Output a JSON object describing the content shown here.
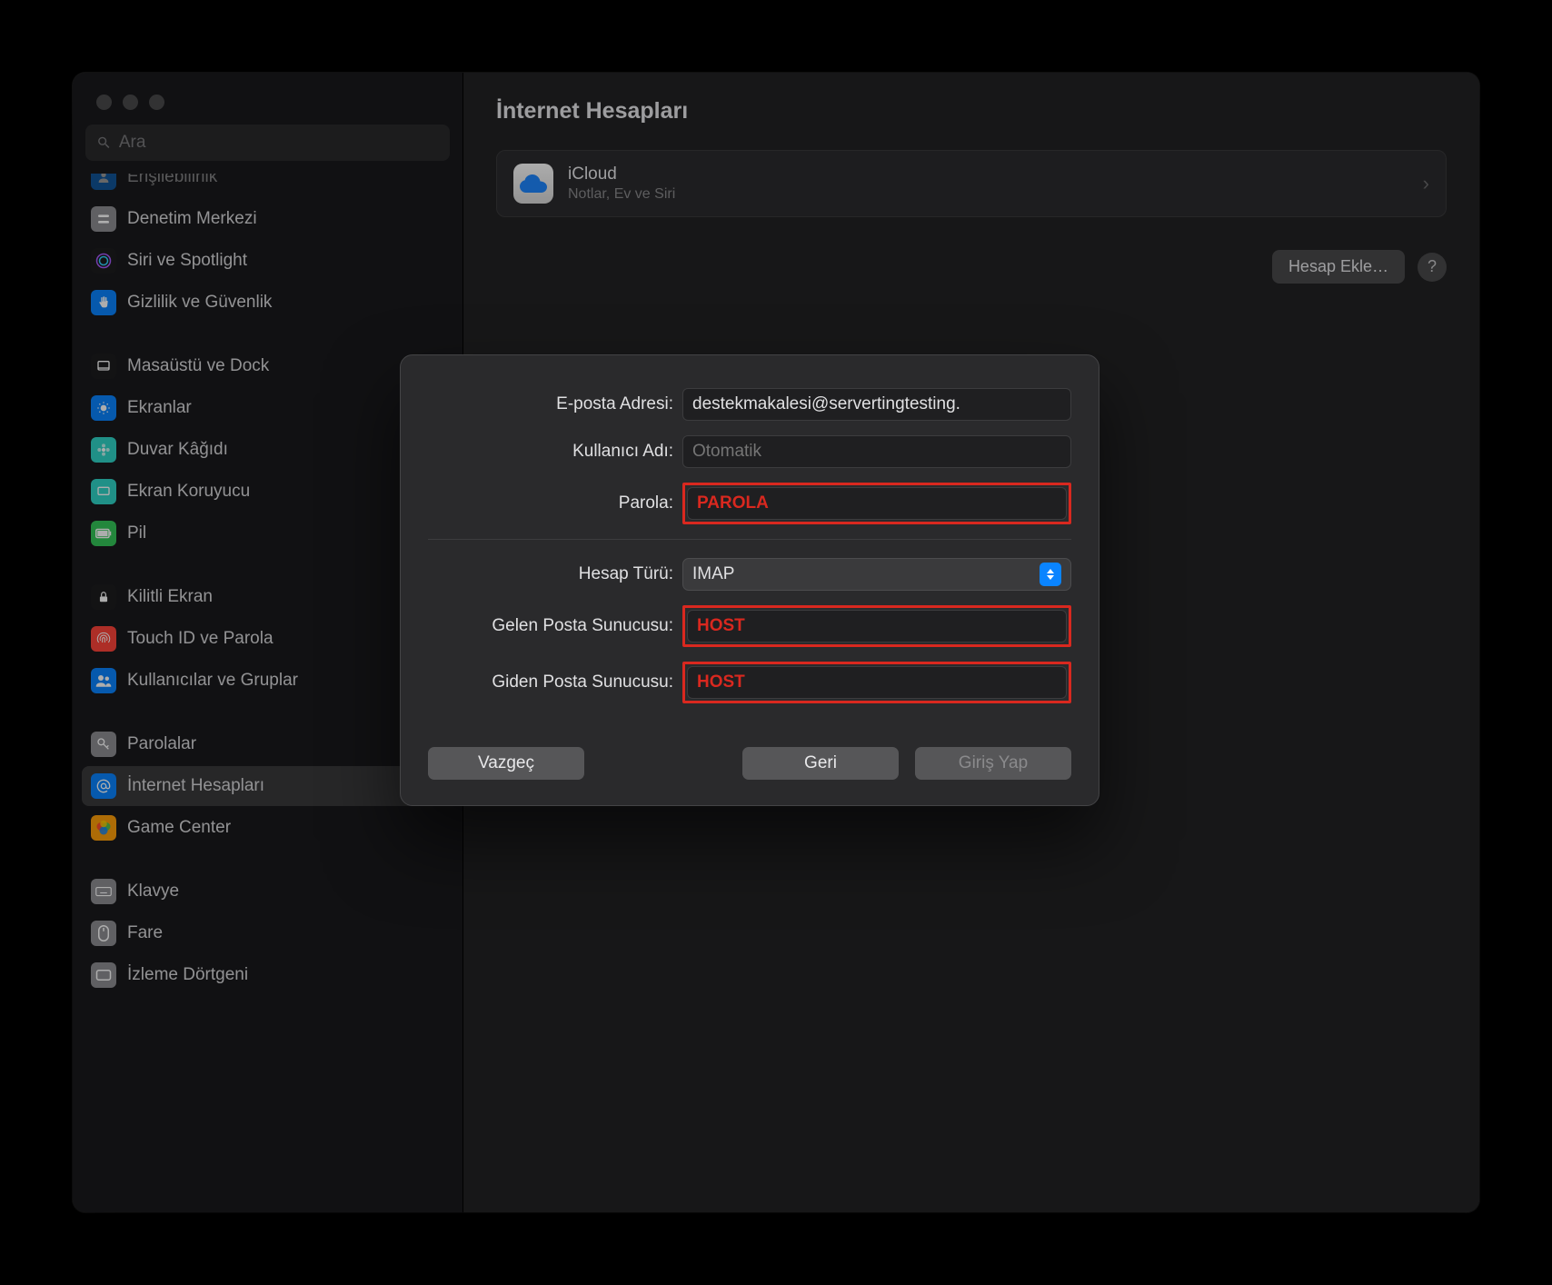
{
  "search": {
    "placeholder": "Ara"
  },
  "sidebar": {
    "items": [
      {
        "label": "Erişilebilirlik",
        "icon_bg": "#0a84ff",
        "glyph": "person"
      },
      {
        "label": "Denetim Merkezi",
        "icon_bg": "#8e8e93",
        "glyph": "switches"
      },
      {
        "label": "Siri ve Spotlight",
        "icon_bg": "#1c1c1e",
        "glyph": "siri"
      },
      {
        "label": "Gizlilik ve Güvenlik",
        "icon_bg": "#0a84ff",
        "glyph": "hand"
      },
      {
        "gap": true
      },
      {
        "label": "Masaüstü ve Dock",
        "icon_bg": "#1c1c1e",
        "glyph": "dock"
      },
      {
        "label": "Ekranlar",
        "icon_bg": "#0a84ff",
        "glyph": "display"
      },
      {
        "label": "Duvar Kâğıdı",
        "icon_bg": "#30d5c8",
        "glyph": "flower"
      },
      {
        "label": "Ekran Koruyucu",
        "icon_bg": "#30d5c8",
        "glyph": "screensaver"
      },
      {
        "label": "Pil",
        "icon_bg": "#34c759",
        "glyph": "battery"
      },
      {
        "gap": true
      },
      {
        "label": "Kilitli Ekran",
        "icon_bg": "#1c1c1e",
        "glyph": "lock"
      },
      {
        "label": "Touch ID ve Parola",
        "icon_bg": "#ff453a",
        "glyph": "fingerprint"
      },
      {
        "label": "Kullanıcılar ve Gruplar",
        "icon_bg": "#0a84ff",
        "glyph": "users"
      },
      {
        "gap": true
      },
      {
        "label": "Parolalar",
        "icon_bg": "#8e8e93",
        "glyph": "key"
      },
      {
        "label": "İnternet Hesapları",
        "icon_bg": "#0a84ff",
        "glyph": "at",
        "active": true
      },
      {
        "label": "Game Center",
        "icon_bg": "#ff9f0a",
        "glyph": "gamecenter"
      },
      {
        "gap": true
      },
      {
        "label": "Klavye",
        "icon_bg": "#8e8e93",
        "glyph": "keyboard"
      },
      {
        "label": "Fare",
        "icon_bg": "#8e8e93",
        "glyph": "mouse"
      },
      {
        "label": "İzleme Dörtgeni",
        "icon_bg": "#8e8e93",
        "glyph": "trackpad"
      }
    ]
  },
  "header": {
    "title": "İnternet Hesapları"
  },
  "account": {
    "title": "iCloud",
    "sub": "Notlar, Ev ve Siri"
  },
  "toolbar": {
    "add_label": "Hesap Ekle…",
    "help_label": "?"
  },
  "modal": {
    "labels": {
      "email": "E-posta Adresi:",
      "username": "Kullanıcı Adı:",
      "password": "Parola:",
      "account_type": "Hesap Türü:",
      "incoming": "Gelen Posta Sunucusu:",
      "outgoing": "Giden Posta Sunucusu:"
    },
    "values": {
      "email": "destekmakalesi@servertingtesting.",
      "username_placeholder": "Otomatik",
      "password": "PAROLA",
      "account_type": "IMAP",
      "incoming": "HOST",
      "outgoing": "HOST"
    },
    "buttons": {
      "cancel": "Vazgeç",
      "back": "Geri",
      "signin": "Giriş Yap"
    }
  }
}
